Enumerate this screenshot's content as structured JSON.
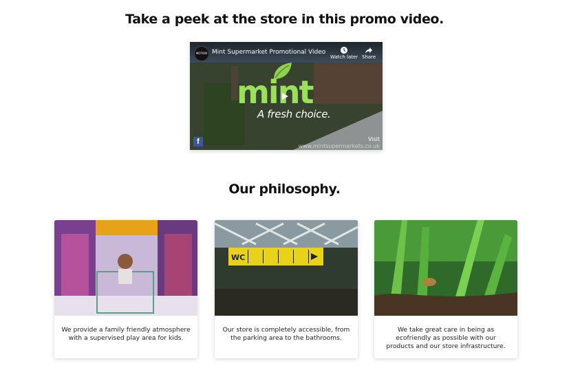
{
  "promo": {
    "heading": "Take a peek at the store in this promo video."
  },
  "video": {
    "title": "Mint Supermarket Promotional Video",
    "channel_avatar_text": "MOTION",
    "watch_later_label": "Watch later",
    "share_label": "Share",
    "logo_text": "mint",
    "tagline": "A fresh choice.",
    "visit_label": "Visit",
    "visit_url": "www.mintsupermarkets.co.uk",
    "facebook_glyph": "f",
    "icons": [
      "clock-icon",
      "share-arrow-icon",
      "play-icon",
      "facebook-icon",
      "leaf-icon"
    ],
    "accent_color": "#9be05a"
  },
  "philosophy": {
    "heading": "Our philosophy.",
    "cards": [
      {
        "text": "We provide a family friendly atmosphere with a supervised play area for kids.",
        "image": "toy-aisle-child-in-cart"
      },
      {
        "text": "Our store is completely accessible, from the parking area to the bathrooms.",
        "image": "accessibility-sign",
        "sign_label": "WC"
      },
      {
        "text": "We take great care in being as ecofriendly as possible with our products and our store infrastructure.",
        "image": "green-sprouts"
      }
    ]
  }
}
